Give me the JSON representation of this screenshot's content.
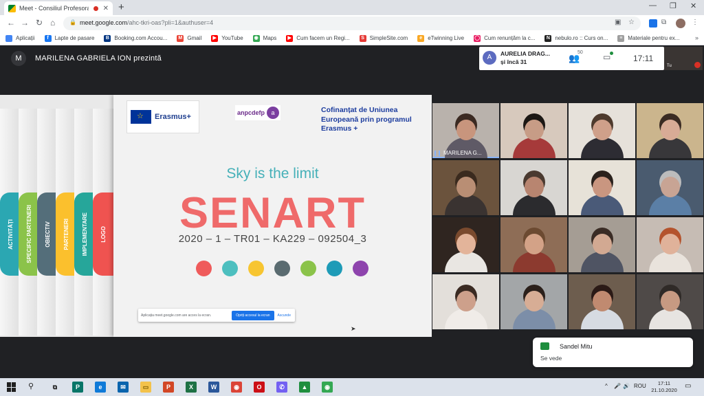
{
  "browser": {
    "tab_title": "Meet - Consiliul Profesoral",
    "tab_close": "✕",
    "new_tab": "+",
    "window_controls": [
      "—",
      "❐",
      "✕"
    ],
    "url_host": "meet.google.com",
    "url_rest": "/ahc-tkri-oas?pli=1&authuser=4",
    "lock": "🔒",
    "nav": [
      "←",
      "→",
      "↻",
      "⌂"
    ],
    "toolbar_icons": [
      "▣",
      "☆",
      "⧉",
      "⋮"
    ],
    "bookmarks": [
      {
        "label": "Aplicații",
        "icon": "apps-icon",
        "color": "#4285f4",
        "glyph": ""
      },
      {
        "label": "Lapte de pasare",
        "icon": "facebook-icon",
        "color": "#1877f2",
        "glyph": "f"
      },
      {
        "label": "Booking.com Accou...",
        "icon": "booking-icon",
        "color": "#003580",
        "glyph": "B"
      },
      {
        "label": "Gmail",
        "icon": "gmail-icon",
        "color": "#ea4335",
        "glyph": "M"
      },
      {
        "label": "YouTube",
        "icon": "youtube-icon",
        "color": "#ff0000",
        "glyph": "▶"
      },
      {
        "label": "Maps",
        "icon": "maps-icon",
        "color": "#34a853",
        "glyph": "◉"
      },
      {
        "label": "Cum facem un Regi...",
        "icon": "youtube-icon",
        "color": "#ff0000",
        "glyph": "▶"
      },
      {
        "label": "SimpleSite.com",
        "icon": "simplesite-icon",
        "color": "#e53935",
        "glyph": "S"
      },
      {
        "label": "eTwinning Live",
        "icon": "etwinning-icon",
        "color": "#f9a825",
        "glyph": "e"
      },
      {
        "label": "Cum renunțăm la c...",
        "icon": "site-icon",
        "color": "#e91e63",
        "glyph": "◯"
      },
      {
        "label": "nebulo.ro :: Curs on...",
        "icon": "nebulo-icon",
        "color": "#222222",
        "glyph": "N"
      },
      {
        "label": "Materiale pentru ex...",
        "icon": "doc-icon",
        "color": "#9e9e9e",
        "glyph": "≡"
      }
    ],
    "bookmarks_more": "»"
  },
  "meet": {
    "presenter_initial": "M",
    "presenting_label": "MARILENA GABRIELA ION prezintă",
    "participant_initial": "A",
    "participant_name": "AURELIA DRAG...",
    "participant_more": "și încă 31",
    "people_count": "50",
    "time": "17:11",
    "self_label": "Tu"
  },
  "slide": {
    "erasmus_label": "Erasmus+",
    "anpcdefp_label": "anpcdefp",
    "anpcdefp_glyph": "a",
    "cofin_text": "Cofinanțat de Uniunea Europeană prin programul Erasmus +",
    "tagline": "Sky is the limit",
    "title": "SENART",
    "project_code": "2020 – 1 – TR01 – KA229 – 092504_3",
    "spine_tabs": [
      {
        "label": "ACTIVITĂȚI",
        "color": "#2ba7b2"
      },
      {
        "label": "SPECIFIC PARTENERI",
        "color": "#8bc34a"
      },
      {
        "label": "OBIECTIV",
        "color": "#546e7a"
      },
      {
        "label": "PARTENERI",
        "color": "#fbc02d"
      },
      {
        "label": "IMPLEMENTARE",
        "color": "#26a69a"
      },
      {
        "label": "LOGO",
        "color": "#ef5350"
      }
    ],
    "dot_colors": [
      "#ef5b5b",
      "#4dbfbf",
      "#f7c531",
      "#5a6b70",
      "#8bc34a",
      "#1e9bb7",
      "#8e44ad"
    ],
    "share_text": "Aplicația meet.google.com are acces la ecran.",
    "share_stop": "Opriți accesul la ecran",
    "share_hide": "Ascunde"
  },
  "grid": {
    "tiles": [
      {
        "label": "MARILENA G...",
        "bg": "#b9b2ac",
        "skin": "#c8957d",
        "hair": "#3b2a22",
        "top": "#5f5a66",
        "speaking": true
      },
      {
        "label": "",
        "bg": "#d7c9bd",
        "skin": "#c79c86",
        "hair": "#1c1714",
        "top": "#a63a3a",
        "speaking": false
      },
      {
        "label": "",
        "bg": "#e6e1da",
        "skin": "#cfa08a",
        "hair": "#4e3a2d",
        "top": "#2d2c33",
        "speaking": false
      },
      {
        "label": "",
        "bg": "#cbb58d",
        "skin": "#d8ab96",
        "hair": "#3a2b23",
        "top": "#38373a",
        "speaking": false
      },
      {
        "label": "",
        "bg": "#6b533d",
        "skin": "#b98e74",
        "hair": "#3a2a1e",
        "top": "#3a3331",
        "speaking": false
      },
      {
        "label": "",
        "bg": "#d8d6d2",
        "skin": "#b88570",
        "hair": "#4a3a30",
        "top": "#2b2b2e",
        "speaking": false
      },
      {
        "label": "",
        "bg": "#e7e2d8",
        "skin": "#c99680",
        "hair": "#2a211c",
        "top": "#4a5a78",
        "speaking": false
      },
      {
        "label": "",
        "bg": "#4a5b6f",
        "skin": "#c8a494",
        "hair": "#bcbcbc",
        "top": "#5b7fa6",
        "speaking": false
      },
      {
        "label": "",
        "bg": "#2f2520",
        "skin": "#e3b49a",
        "hair": "#7a4a2e",
        "top": "#e9e6e2",
        "speaking": false
      },
      {
        "label": "",
        "bg": "#8e6d56",
        "skin": "#d3a287",
        "hair": "#6c4a31",
        "top": "#8c3a2f",
        "speaking": false
      },
      {
        "label": "",
        "bg": "#a59d94",
        "skin": "#d2a992",
        "hair": "#3a2c25",
        "top": "#4f5463",
        "speaking": false
      },
      {
        "label": "",
        "bg": "#c6bcb4",
        "skin": "#e0b29a",
        "hair": "#b4532d",
        "top": "#e9e3dc",
        "speaking": false
      },
      {
        "label": "",
        "bg": "#e3dfda",
        "skin": "#cda08b",
        "hair": "#3a2a22",
        "top": "#f0ece8",
        "speaking": false
      },
      {
        "label": "",
        "bg": "#a3a6a8",
        "skin": "#d7ad95",
        "hair": "#2b201b",
        "top": "#7c8ea8",
        "speaking": false
      },
      {
        "label": "",
        "bg": "#6d5d4e",
        "skin": "#c08a70",
        "hair": "#2b1a16",
        "top": "#d6dbe2",
        "speaking": false
      },
      {
        "label": "",
        "bg": "#4f4a48",
        "skin": "#c79a82",
        "hair": "#2f2a27",
        "top": "#e7e4e1",
        "speaking": false
      }
    ]
  },
  "toast": {
    "sender": "Sandel Mitu",
    "message": "Se vede"
  },
  "taskbar": {
    "search_glyph": "⚲",
    "apps": [
      {
        "icon": "task-view-icon",
        "glyph": "⧉",
        "color": "#dce2eb",
        "fg": "#222222"
      },
      {
        "icon": "publisher-icon",
        "glyph": "P",
        "color": "#077568",
        "fg": "#ffffff"
      },
      {
        "icon": "edge-icon",
        "glyph": "e",
        "color": "#0f7ad8",
        "fg": "#ffffff"
      },
      {
        "icon": "mail-icon",
        "glyph": "✉",
        "color": "#0a64ad",
        "fg": "#ffffff"
      },
      {
        "icon": "file-explorer-icon",
        "glyph": "▭",
        "color": "#f3c24b",
        "fg": "#7a5a00"
      },
      {
        "icon": "powerpoint-icon",
        "glyph": "P",
        "color": "#d24726",
        "fg": "#ffffff"
      },
      {
        "icon": "excel-icon",
        "glyph": "X",
        "color": "#1e7145",
        "fg": "#ffffff"
      },
      {
        "icon": "word-icon",
        "glyph": "W",
        "color": "#2b579a",
        "fg": "#ffffff"
      },
      {
        "icon": "chrome-icon",
        "glyph": "◉",
        "color": "#db4437",
        "fg": "#ffffff"
      },
      {
        "icon": "opera-icon",
        "glyph": "O",
        "color": "#cc0f16",
        "fg": "#ffffff"
      },
      {
        "icon": "viber-icon",
        "glyph": "✆",
        "color": "#7360f2",
        "fg": "#ffffff"
      },
      {
        "icon": "meet-app-icon",
        "glyph": "▲",
        "color": "#1e8e3e",
        "fg": "#ffffff"
      },
      {
        "icon": "chrome-profile-icon",
        "glyph": "◉",
        "color": "#34a853",
        "fg": "#ffffff"
      }
    ],
    "tray_chevron": "^",
    "tray_mic": "🎤",
    "tray_speaker": "🔊",
    "language": "ROU",
    "time": "17:11",
    "date": "21.10.2020",
    "notification_glyph": "▭"
  }
}
